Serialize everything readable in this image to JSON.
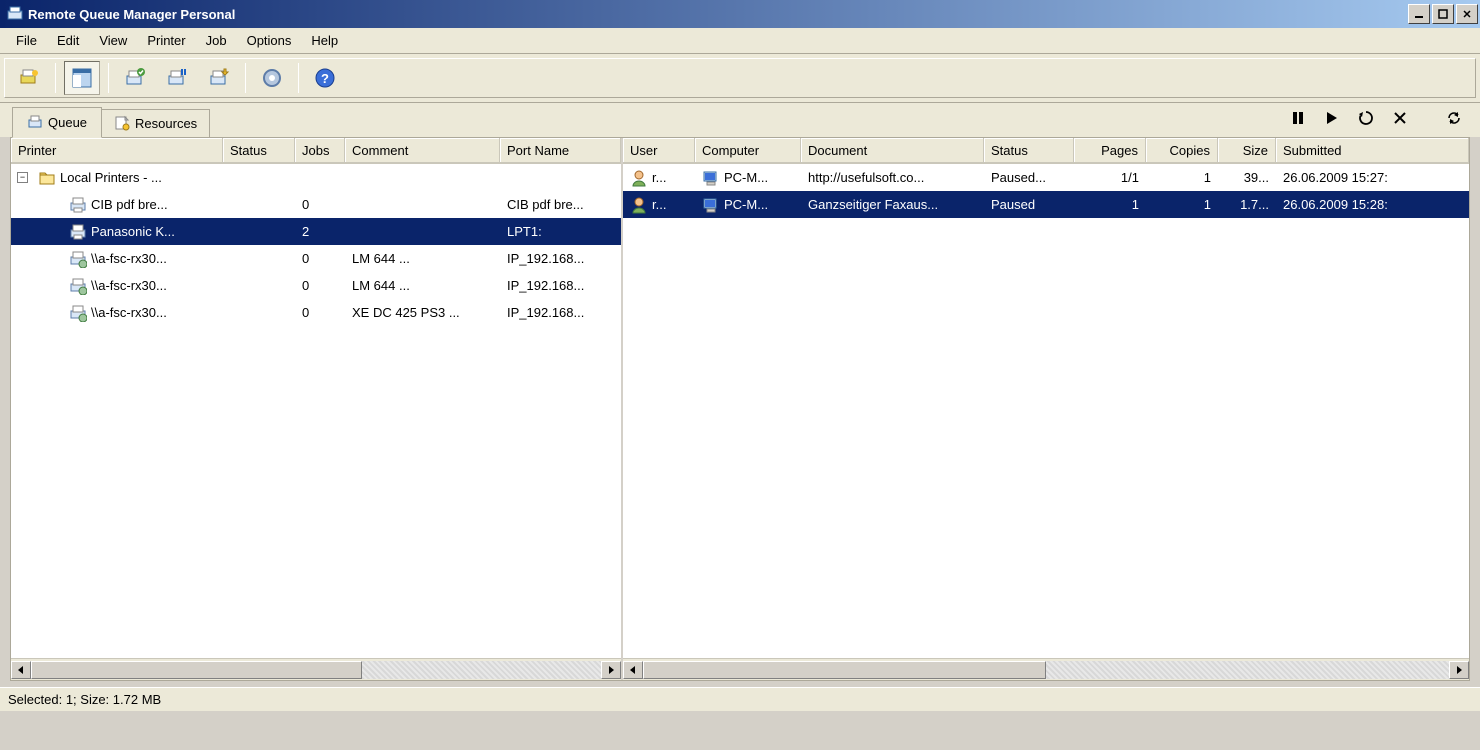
{
  "window": {
    "title": "Remote Queue Manager Personal"
  },
  "menubar": [
    "File",
    "Edit",
    "View",
    "Printer",
    "Job",
    "Options",
    "Help"
  ],
  "tabs": [
    {
      "label": "Queue",
      "active": true
    },
    {
      "label": "Resources",
      "active": false
    }
  ],
  "printer_columns": {
    "printer": "Printer",
    "status": "Status",
    "jobs": "Jobs",
    "comment": "Comment",
    "port": "Port Name"
  },
  "printer_group": "Local Printers - ...",
  "printers": [
    {
      "name": "CIB pdf bre...",
      "status": "",
      "jobs": "0",
      "comment": "",
      "port": "CIB pdf bre...",
      "type": "printer",
      "selected": false
    },
    {
      "name": "Panasonic K...",
      "status": "",
      "jobs": "2",
      "comment": "",
      "port": "LPT1:",
      "type": "printer",
      "selected": true
    },
    {
      "name": "\\\\a-fsc-rx30...",
      "status": "",
      "jobs": "0",
      "comment": "LM 644             ...",
      "port": "IP_192.168...",
      "type": "network",
      "selected": false
    },
    {
      "name": "\\\\a-fsc-rx30...",
      "status": "",
      "jobs": "0",
      "comment": "LM 644             ...",
      "port": "IP_192.168...",
      "type": "network",
      "selected": false
    },
    {
      "name": "\\\\a-fsc-rx30...",
      "status": "",
      "jobs": "0",
      "comment": "XE DC 425 PS3 ...",
      "port": "IP_192.168...",
      "type": "network",
      "selected": false
    }
  ],
  "job_columns": {
    "user": "User",
    "computer": "Computer",
    "document": "Document",
    "status": "Status",
    "pages": "Pages",
    "copies": "Copies",
    "size": "Size",
    "submitted": "Submitted"
  },
  "jobs": [
    {
      "user": "r...",
      "computer": "PC-M...",
      "document": "http://usefulsoft.co...",
      "status": "Paused...",
      "pages": "1/1",
      "copies": "1",
      "size": "39...",
      "submitted": "26.06.2009 15:27:",
      "selected": false
    },
    {
      "user": "r...",
      "computer": "PC-M...",
      "document": "Ganzseitiger Faxaus...",
      "status": "Paused",
      "pages": "1",
      "copies": "1",
      "size": "1.7...",
      "submitted": "26.06.2009 15:28:",
      "selected": true
    }
  ],
  "statusbar": "Selected: 1; Size: 1.72 MB"
}
